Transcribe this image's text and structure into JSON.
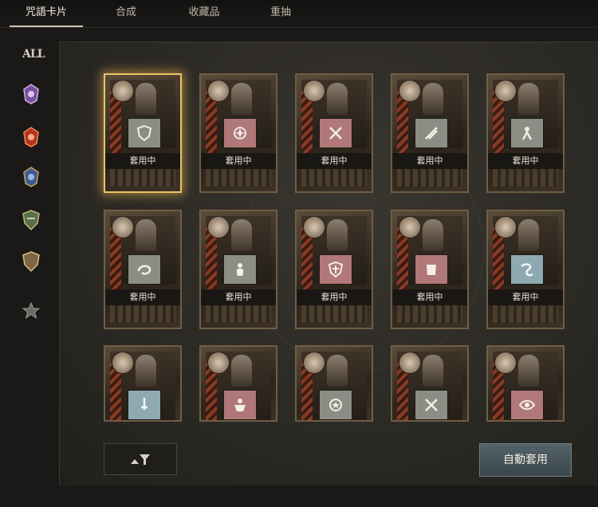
{
  "tabs": [
    {
      "label": "咒語卡片",
      "active": true
    },
    {
      "label": "合成",
      "active": false
    },
    {
      "label": "收藏品",
      "active": false
    },
    {
      "label": "重抽",
      "active": false
    }
  ],
  "sidebar": {
    "all_label": "ALL",
    "icons": [
      "purple-crest-icon",
      "red-crest-icon",
      "blue-crest-icon",
      "green-shield-icon",
      "shield-icon",
      "star-icon"
    ]
  },
  "cards": [
    {
      "rune": "shield-icon",
      "rune_color": "#8d8d86",
      "status": "套用中",
      "selected": true
    },
    {
      "rune": "swirl-icon",
      "rune_color": "#b07878",
      "status": "套用中"
    },
    {
      "rune": "crossed-swords-icon",
      "rune_color": "#b07878",
      "status": "套用中"
    },
    {
      "rune": "slash-icon",
      "rune_color": "#8d8d86",
      "status": "套用中"
    },
    {
      "rune": "figure-icon",
      "rune_color": "#8d8d86",
      "status": "套用中"
    },
    {
      "rune": "dragon-icon",
      "rune_color": "#8d8d86",
      "status": "套用中"
    },
    {
      "rune": "warrior-icon",
      "rune_color": "#8d8d86",
      "status": "套用中"
    },
    {
      "rune": "cross-shield-icon",
      "rune_color": "#b07878",
      "status": "套用中"
    },
    {
      "rune": "armor-icon",
      "rune_color": "#b07878",
      "status": "套用中"
    },
    {
      "rune": "serpent-icon",
      "rune_color": "#8fa9b3",
      "status": "套用中"
    },
    {
      "rune": "sword-icon",
      "rune_color": "#8fa9b3"
    },
    {
      "rune": "muscle-icon",
      "rune_color": "#b07878"
    },
    {
      "rune": "star-ring-icon",
      "rune_color": "#8d8d86"
    },
    {
      "rune": "crossed-swords-icon",
      "rune_color": "#8d8d86"
    },
    {
      "rune": "eye-icon",
      "rune_color": "#b07878"
    }
  ],
  "controls": {
    "filter_icon": "sort-filter-icon",
    "auto_apply_label": "自動套用"
  }
}
